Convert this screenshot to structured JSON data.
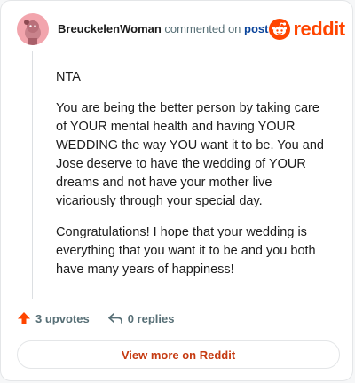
{
  "header": {
    "username": "BreuckelenWoman",
    "action_text": "commented on",
    "target_text": "post",
    "brand_name": "reddit",
    "avatar_icon": "snoo-avatar-icon",
    "brand_icon": "reddit-logo-icon"
  },
  "comment": {
    "paragraphs": [
      "NTA",
      "You are being the better person by taking care of YOUR mental health and having YOUR WEDDING the way YOU want it to be. You and Jose deserve to have the wedding of YOUR dreams and not have your mother live vicariously through your special day.",
      "Congratulations! I hope that your wedding is everything that you want it to be and you both have many years of happiness!"
    ]
  },
  "actions": {
    "upvotes_label": "3 upvotes",
    "replies_label": "0 replies",
    "upvote_icon": "upvote-arrow-icon",
    "reply_icon": "reply-arrow-icon"
  },
  "footer": {
    "view_more_label": "View more on Reddit"
  },
  "colors": {
    "accent": "#ff4500",
    "link": "#0a449b",
    "button_text": "#c53a11",
    "avatar_bg": "#f2a5ad"
  }
}
